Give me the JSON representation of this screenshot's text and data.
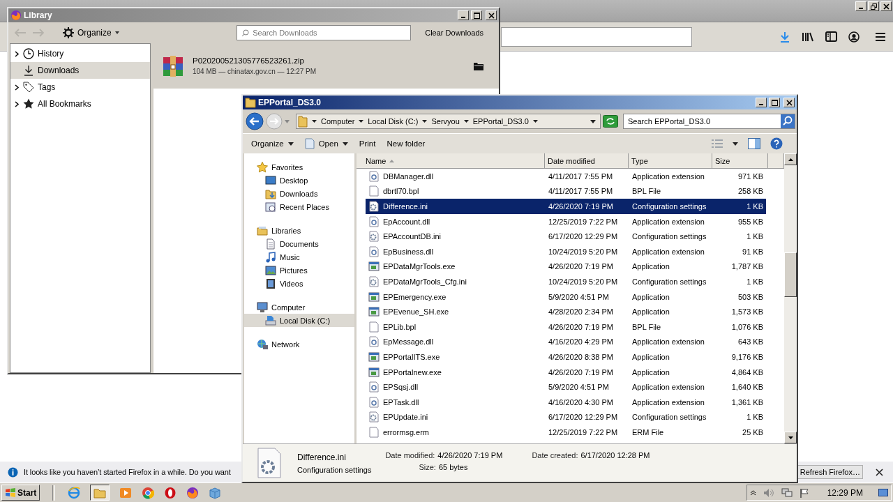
{
  "browser": {
    "notification": {
      "text": "It looks like you haven’t started Firefox in a while. Do you want",
      "button": "Refresh Firefox…"
    }
  },
  "library": {
    "title": "Library",
    "organize": "Organize",
    "search": {
      "placeholder": "Search Downloads"
    },
    "clear_button": "Clear Downloads",
    "sidebar": [
      {
        "label": "History",
        "expandable": true,
        "selected": false
      },
      {
        "label": "Downloads",
        "expandable": false,
        "selected": true
      },
      {
        "label": "Tags",
        "expandable": true,
        "selected": false
      },
      {
        "label": "All Bookmarks",
        "expandable": true,
        "selected": false
      }
    ],
    "downloads": [
      {
        "name": "P020200521305776523261.zip",
        "meta": "104 MB — chinatax.gov.cn — 12:27 PM"
      }
    ]
  },
  "explorer": {
    "title": "EPPortal_DS3.0",
    "breadcrumb": [
      "Computer",
      "Local Disk (C:)",
      "Servyou",
      "EPPortal_DS3.0"
    ],
    "search": {
      "placeholder": "Search EPPortal_DS3.0"
    },
    "commands": [
      {
        "label": "Organize",
        "dropdown": true,
        "icon": false
      },
      {
        "label": "Open",
        "dropdown": true,
        "icon": true
      },
      {
        "label": "Print",
        "dropdown": false,
        "icon": false
      },
      {
        "label": "New folder",
        "dropdown": false,
        "icon": false
      }
    ],
    "nav": [
      {
        "label": "Favorites",
        "children": [
          {
            "label": "Desktop",
            "selected": false
          },
          {
            "label": "Downloads",
            "selected": false
          },
          {
            "label": "Recent Places",
            "selected": false
          }
        ]
      },
      {
        "label": "Libraries",
        "children": [
          {
            "label": "Documents",
            "selected": false
          },
          {
            "label": "Music",
            "selected": false
          },
          {
            "label": "Pictures",
            "selected": false
          },
          {
            "label": "Videos",
            "selected": false
          }
        ]
      },
      {
        "label": "Computer",
        "children": [
          {
            "label": "Local Disk (C:)",
            "selected": true
          }
        ]
      },
      {
        "label": "Network"
      }
    ],
    "columns": [
      {
        "label": "Name",
        "sorted": true
      },
      {
        "label": "Date modified",
        "sorted": false
      },
      {
        "label": "Type",
        "sorted": false
      },
      {
        "label": "Size",
        "sorted": false
      }
    ],
    "rows": [
      {
        "name": "DBManager.dll",
        "date": "4/11/2017 7:55 PM",
        "type": "Application extension",
        "size": "971 KB",
        "kind": "dll",
        "selected": false
      },
      {
        "name": "dbrtl70.bpl",
        "date": "4/11/2017 7:55 PM",
        "type": "BPL File",
        "size": "258 KB",
        "kind": "file",
        "selected": false
      },
      {
        "name": "Difference.ini",
        "date": "4/26/2020 7:19 PM",
        "type": "Configuration settings",
        "size": "1 KB",
        "kind": "ini",
        "selected": true
      },
      {
        "name": "EpAccount.dll",
        "date": "12/25/2019 7:22 PM",
        "type": "Application extension",
        "size": "955 KB",
        "kind": "dll",
        "selected": false
      },
      {
        "name": "EPAccountDB.ini",
        "date": "6/17/2020 12:29 PM",
        "type": "Configuration settings",
        "size": "1 KB",
        "kind": "ini",
        "selected": false
      },
      {
        "name": "EpBusiness.dll",
        "date": "10/24/2019 5:20 PM",
        "type": "Application extension",
        "size": "91 KB",
        "kind": "dll",
        "selected": false
      },
      {
        "name": "EPDataMgrTools.exe",
        "date": "4/26/2020 7:19 PM",
        "type": "Application",
        "size": "1,787 KB",
        "kind": "exe",
        "selected": false
      },
      {
        "name": "EPDataMgrTools_Cfg.ini",
        "date": "10/24/2019 5:20 PM",
        "type": "Configuration settings",
        "size": "1 KB",
        "kind": "ini",
        "selected": false
      },
      {
        "name": "EPEmergency.exe",
        "date": "5/9/2020 4:51 PM",
        "type": "Application",
        "size": "503 KB",
        "kind": "exe",
        "selected": false
      },
      {
        "name": "EPEvenue_SH.exe",
        "date": "4/28/2020 2:34 PM",
        "type": "Application",
        "size": "1,573 KB",
        "kind": "exe",
        "selected": false
      },
      {
        "name": "EPLib.bpl",
        "date": "4/26/2020 7:19 PM",
        "type": "BPL File",
        "size": "1,076 KB",
        "kind": "file",
        "selected": false
      },
      {
        "name": "EpMessage.dll",
        "date": "4/16/2020 4:29 PM",
        "type": "Application extension",
        "size": "643 KB",
        "kind": "dll",
        "selected": false
      },
      {
        "name": "EPPortalITS.exe",
        "date": "4/26/2020 8:38 PM",
        "type": "Application",
        "size": "9,176 KB",
        "kind": "exe",
        "selected": false
      },
      {
        "name": "EPPortalnew.exe",
        "date": "4/26/2020 7:19 PM",
        "type": "Application",
        "size": "4,864 KB",
        "kind": "exe",
        "selected": false
      },
      {
        "name": "EPSqsj.dll",
        "date": "5/9/2020 4:51 PM",
        "type": "Application extension",
        "size": "1,640 KB",
        "kind": "dll",
        "selected": false
      },
      {
        "name": "EPTask.dll",
        "date": "4/16/2020 4:30 PM",
        "type": "Application extension",
        "size": "1,361 KB",
        "kind": "dll",
        "selected": false
      },
      {
        "name": "EPUpdate.ini",
        "date": "6/17/2020 12:29 PM",
        "type": "Configuration settings",
        "size": "1 KB",
        "kind": "ini",
        "selected": false
      },
      {
        "name": "errormsg.erm",
        "date": "12/25/2019 7:22 PM",
        "type": "ERM File",
        "size": "25 KB",
        "kind": "file",
        "selected": false
      }
    ],
    "details": {
      "name": "Difference.ini",
      "type": "Configuration settings",
      "fields": [
        {
          "label": "Date modified:",
          "value": "4/26/2020 7:19 PM"
        },
        {
          "label": "Date created:",
          "value": "6/17/2020 12:28 PM"
        },
        {
          "label": "Size:",
          "value": "65 bytes"
        }
      ]
    }
  },
  "taskbar": {
    "start": "Start",
    "clock": "12:29 PM"
  }
}
